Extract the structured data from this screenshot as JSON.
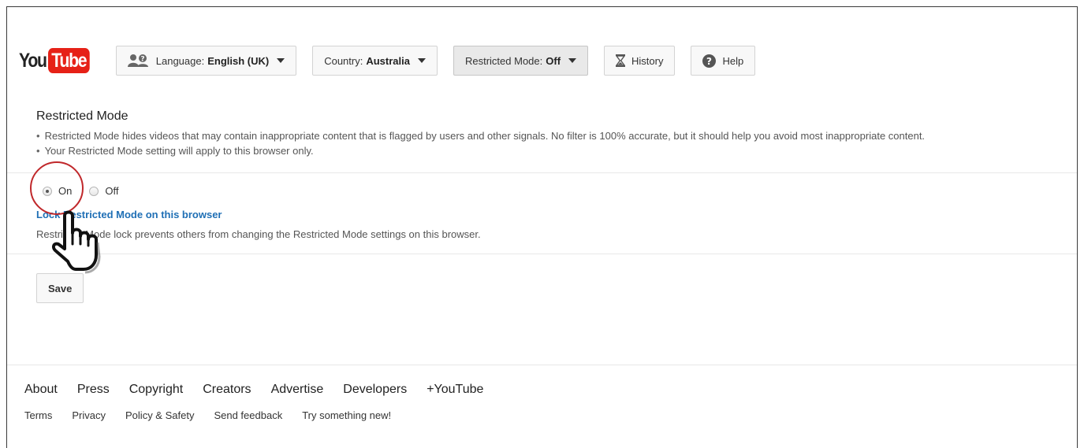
{
  "logo": {
    "you": "You",
    "tube": "Tube"
  },
  "header": {
    "language": {
      "label": "Language:",
      "value": "English (UK)"
    },
    "country": {
      "label": "Country:",
      "value": "Australia"
    },
    "restricted": {
      "label": "Restricted Mode:",
      "value": "Off"
    },
    "history": "History",
    "help": "Help"
  },
  "content": {
    "title": "Restricted Mode",
    "bullets": [
      "Restricted Mode hides videos that may contain inappropriate content that is flagged by users and other signals. No filter is 100% accurate, but it should help you avoid most inappropriate content.",
      "Your Restricted Mode setting will apply to this browser only."
    ],
    "options": [
      {
        "label": "On",
        "checked": true
      },
      {
        "label": "Off",
        "checked": false
      }
    ],
    "lock_link": "Lock Restricted Mode on this browser",
    "lock_desc": "Restricted Mode lock prevents others from changing the Restricted Mode settings on this browser.",
    "save": "Save"
  },
  "footer": {
    "primary": [
      "About",
      "Press",
      "Copyright",
      "Creators",
      "Advertise",
      "Developers",
      "+YouTube"
    ],
    "secondary": [
      "Terms",
      "Privacy",
      "Policy & Safety",
      "Send feedback",
      "Try something new!"
    ]
  },
  "colors": {
    "brand_red": "#e62117",
    "link_blue": "#1f6fb5",
    "annotation_red": "#c0282b"
  },
  "icons": [
    "language-people-icon",
    "hourglass-icon",
    "help-icon",
    "pointing-hand-icon"
  ]
}
